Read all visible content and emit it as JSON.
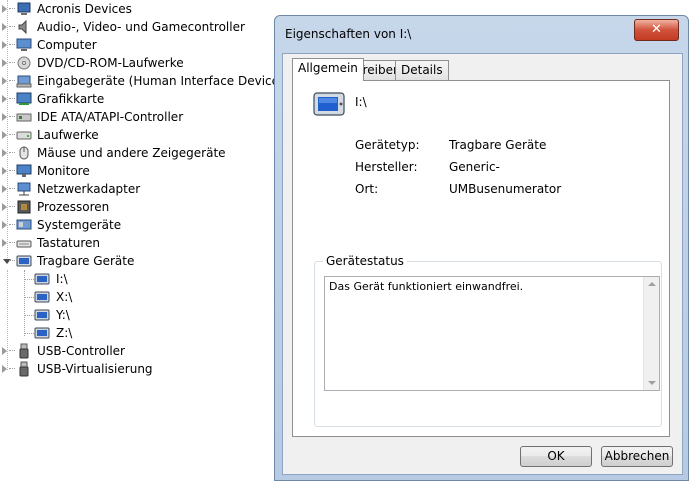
{
  "tree": {
    "items": [
      {
        "label": "Acronis Devices",
        "icon": "acronis-device-icon",
        "state": "collapsed"
      },
      {
        "label": "Audio-, Video- und Gamecontroller",
        "icon": "speaker-icon",
        "state": "collapsed"
      },
      {
        "label": "Computer",
        "icon": "computer-icon",
        "state": "collapsed"
      },
      {
        "label": "DVD/CD-ROM-Laufwerke",
        "icon": "dvd-drive-icon",
        "state": "collapsed"
      },
      {
        "label": "Eingabegeräte (Human Interface Devices)",
        "icon": "hid-icon",
        "state": "collapsed"
      },
      {
        "label": "Grafikkarte",
        "icon": "display-adapter-icon",
        "state": "collapsed"
      },
      {
        "label": "IDE ATA/ATAPI-Controller",
        "icon": "ide-controller-icon",
        "state": "collapsed"
      },
      {
        "label": "Laufwerke",
        "icon": "disk-drive-icon",
        "state": "collapsed"
      },
      {
        "label": "Mäuse und andere Zeigegeräte",
        "icon": "mouse-icon",
        "state": "collapsed"
      },
      {
        "label": "Monitore",
        "icon": "monitor-icon",
        "state": "collapsed"
      },
      {
        "label": "Netzwerkadapter",
        "icon": "network-adapter-icon",
        "state": "collapsed"
      },
      {
        "label": "Prozessoren",
        "icon": "processor-icon",
        "state": "collapsed"
      },
      {
        "label": "Systemgeräte",
        "icon": "system-devices-icon",
        "state": "collapsed"
      },
      {
        "label": "Tastaturen",
        "icon": "keyboard-icon",
        "state": "collapsed"
      },
      {
        "label": "Tragbare Geräte",
        "icon": "portable-device-icon",
        "state": "expanded"
      }
    ],
    "children": [
      {
        "label": "I:\\",
        "icon": "portable-device-icon"
      },
      {
        "label": "X:\\",
        "icon": "portable-device-icon"
      },
      {
        "label": "Y:\\",
        "icon": "portable-device-icon"
      },
      {
        "label": "Z:\\",
        "icon": "portable-device-icon"
      }
    ],
    "after": [
      {
        "label": "USB-Controller",
        "icon": "usb-icon",
        "state": "collapsed"
      },
      {
        "label": "USB-Virtualisierung",
        "icon": "usb-icon",
        "state": "collapsed"
      }
    ]
  },
  "dialog": {
    "title": "Eigenschaften von I:\\",
    "close_label": "✕",
    "tabs": [
      "Allgemein",
      "Treiber",
      "Details"
    ],
    "device_name": "I:\\",
    "properties": [
      {
        "label": "Gerätetyp:",
        "value": "Tragbare Geräte"
      },
      {
        "label": "Hersteller:",
        "value": "Generic-"
      },
      {
        "label": "Ort:",
        "value": "UMBusenumerator"
      }
    ],
    "status_group_label": "Gerätestatus",
    "status_text": "Das Gerät funktioniert einwandfrei.",
    "ok_label": "OK",
    "cancel_label": "Abbrechen"
  }
}
